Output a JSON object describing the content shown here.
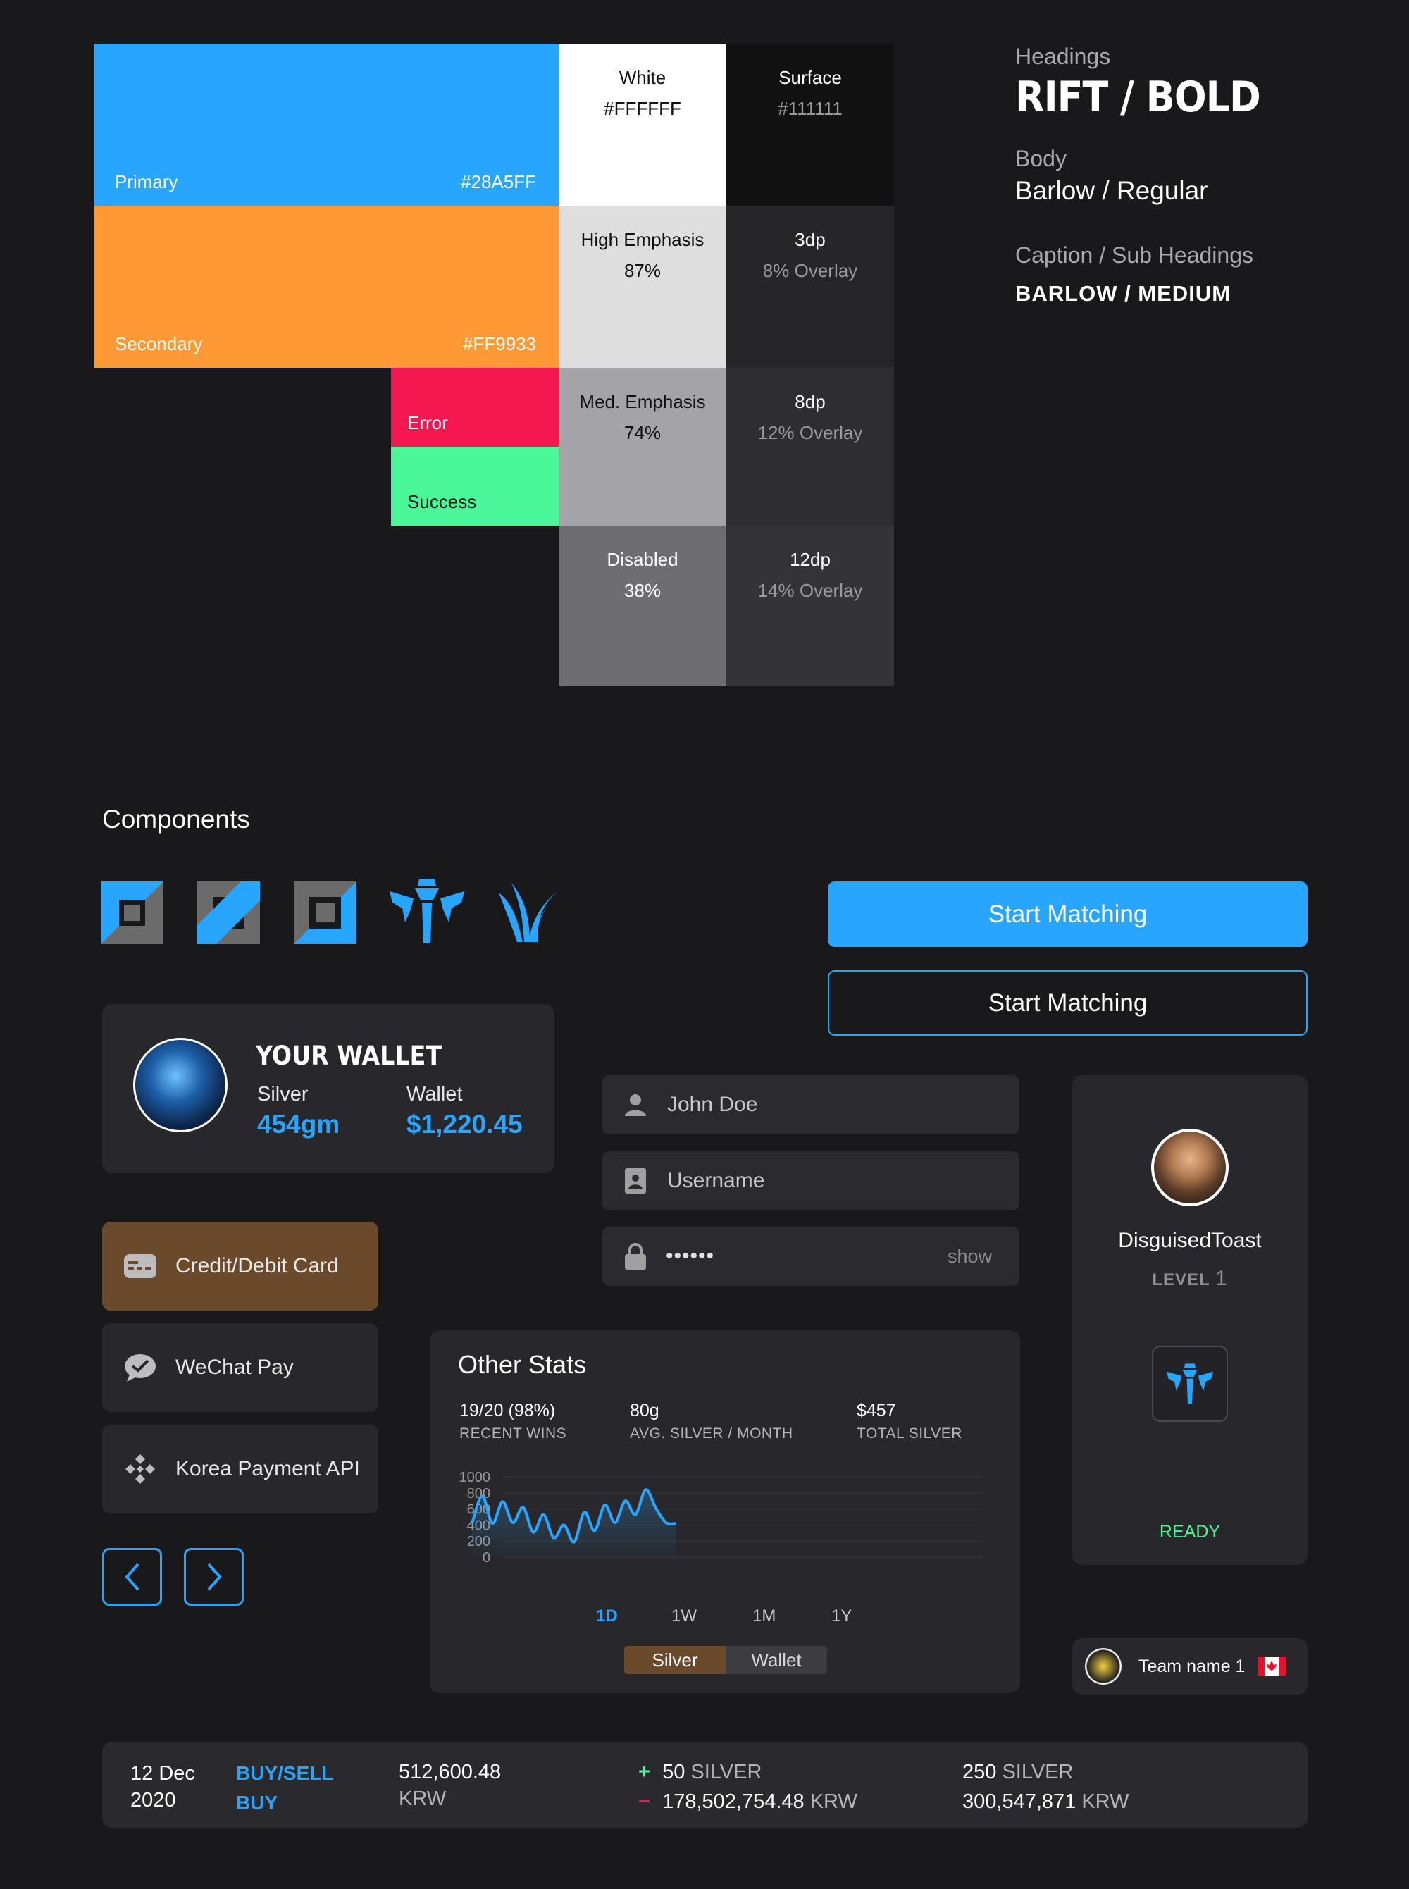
{
  "palette": {
    "primary": {
      "label": "Primary",
      "hex": "#28A5FF",
      "color": "#28A5FF"
    },
    "secondary": {
      "label": "Secondary",
      "hex": "#FF9933",
      "color": "#FF9933"
    },
    "error": {
      "label": "Error",
      "color": "#F5174F"
    },
    "success": {
      "label": "Success",
      "color": "#4AF89A"
    },
    "white": {
      "label": "White",
      "hex": "#FFFFFF"
    },
    "surface": {
      "label": "Surface",
      "hex": "#111111"
    },
    "high_emphasis": {
      "label": "High Emphasis",
      "value": "87%"
    },
    "med_emphasis": {
      "label": "Med. Emphasis",
      "value": "74%"
    },
    "disabled": {
      "label": "Disabled",
      "value": "38%"
    },
    "dp3": {
      "label": "3dp",
      "value": "8% Overlay"
    },
    "dp8": {
      "label": "8dp",
      "value": "12% Overlay"
    },
    "dp12": {
      "label": "12dp",
      "value": "14% Overlay"
    }
  },
  "typography": {
    "headings_label": "Headings",
    "headings_value": "RIFT / BOLD",
    "body_label": "Body",
    "body_value": "Barlow / Regular",
    "caption_label": "Caption / Sub Headings",
    "caption_value": "BARLOW / MEDIUM"
  },
  "components": {
    "title": "Components",
    "button_primary": "Start Matching",
    "button_outline": "Start Matching"
  },
  "wallet": {
    "title": "YOUR WALLET",
    "silver_label": "Silver",
    "silver_value": "454gm",
    "wallet_label": "Wallet",
    "wallet_value": "$1,220.45"
  },
  "form": {
    "name_placeholder": "John Doe",
    "username_placeholder": "Username",
    "password_value": "••••••",
    "show_label": "show"
  },
  "payments": [
    {
      "label": "Credit/Debit Card",
      "icon": "credit-card-icon"
    },
    {
      "label": "WeChat Pay",
      "icon": "wechat-icon"
    },
    {
      "label": "Korea Payment API",
      "icon": "payment-api-icon"
    }
  ],
  "profile": {
    "name": "DisguisedToast",
    "level_label": "LEVEL",
    "level_value": "1",
    "status": "READY",
    "status_color": "#4AF89A"
  },
  "team": {
    "name": "Team name 1",
    "flag": "canada-flag-icon"
  },
  "stats": {
    "title": "Other Stats",
    "items": [
      {
        "value": "19/20 (98%)",
        "label": "RECENT WINS"
      },
      {
        "value": "80g",
        "label": "AVG. SILVER / MONTH"
      },
      {
        "value": "$457",
        "label": "TOTAL SILVER"
      }
    ],
    "ranges": [
      "1D",
      "1W",
      "1M",
      "1Y"
    ],
    "active_range": "1D",
    "toggle": [
      "Silver",
      "Wallet"
    ],
    "active_toggle": "Silver"
  },
  "chart_data": {
    "type": "area",
    "title": "",
    "xlabel": "",
    "ylabel": "",
    "ylim": [
      0,
      1000
    ],
    "yticks": [
      0,
      200,
      400,
      600,
      800,
      1000
    ],
    "grid": true,
    "series": [
      {
        "values": [
          420,
          760,
          420,
          690,
          430,
          620,
          310,
          530,
          240,
          400,
          190,
          560,
          330,
          650,
          430,
          700,
          530,
          840,
          610,
          430,
          420
        ]
      }
    ]
  },
  "transaction": {
    "date_line1": "12 Dec",
    "date_line2": "2020",
    "type_line1": "BUY/SELL",
    "type_line2": "BUY",
    "amount": "512,600.48",
    "amount_unit": "KRW",
    "plus_sign": "+",
    "plus_value": "50",
    "plus_unit": "SILVER",
    "minus_sign": "−",
    "minus_value": "178,502,754.48",
    "minus_unit": "KRW",
    "right_value1": "250",
    "right_unit1": "SILVER",
    "right_value2": "300,547,871",
    "right_unit2": "KRW"
  }
}
